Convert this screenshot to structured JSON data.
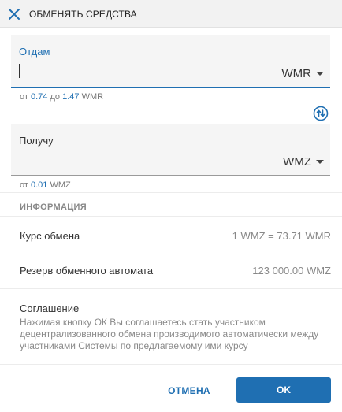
{
  "header": {
    "title": "ОБМЕНЯТЬ СРЕДСТВА"
  },
  "give": {
    "label": "Отдам",
    "value": "",
    "currency": "WMR",
    "range_from_text": "от",
    "range_min": "0.74",
    "range_to_text": "до",
    "range_max": "1.47",
    "range_unit": "WMR"
  },
  "get": {
    "label": "Получу",
    "value": "",
    "currency": "WMZ",
    "range_from_text": "от",
    "range_min": "0.01",
    "range_unit": "WMZ"
  },
  "info": {
    "section_title": "ИНФОРМАЦИЯ",
    "rate_label": "Курс обмена",
    "rate_value": "1 WMZ = 73.71 WMR",
    "reserve_label": "Резерв обменного автомата",
    "reserve_value": "123 000.00 WMZ"
  },
  "agreement": {
    "title": "Соглашение",
    "text": "Нажимая кнопку ОК Вы соглашаетесь стать участником децентрализованного обмена производимого автоматически между участниками Системы по предлагаемому ими курсу"
  },
  "footer": {
    "cancel_label": "ОТМЕНА",
    "ok_label": "OK"
  },
  "colors": {
    "accent": "#1f6fb2",
    "muted": "#888888"
  }
}
